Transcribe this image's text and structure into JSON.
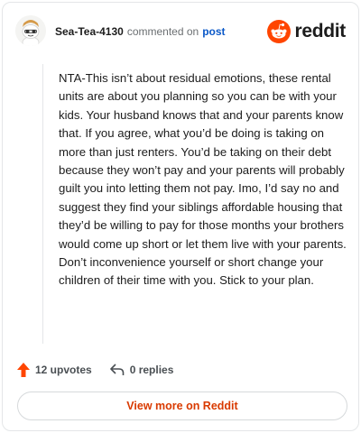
{
  "header": {
    "username": "Sea-Tea-4130",
    "action_text": "commented on",
    "post_link": "post",
    "brand_name": "reddit",
    "brand_color": "#ff4500"
  },
  "comment": {
    "body": "NTA-This isn’t about residual emotions, these rental units are about you planning so you can be with your kids. Your husband knows that and your parents know that. If you agree, what you’d be doing is taking on more than just renters. You’d be taking on their debt because they won’t pay and your parents will probably guilt you into letting them not pay. Imo, I’d say no and suggest they find your siblings affordable housing that they’d be willing to pay for those months your brothers would come up short or let them live with your parents. Don’t inconvenience yourself or short change your children of their time with you. Stick to your plan."
  },
  "footer": {
    "upvotes_label": "12 upvotes",
    "replies_label": "0 replies",
    "upvote_icon": "upvote-arrow-icon",
    "reply_icon": "reply-arrow-icon",
    "upvote_color": "#ff4500"
  },
  "view_more": {
    "label": "View more on Reddit",
    "color": "#d93a00"
  }
}
